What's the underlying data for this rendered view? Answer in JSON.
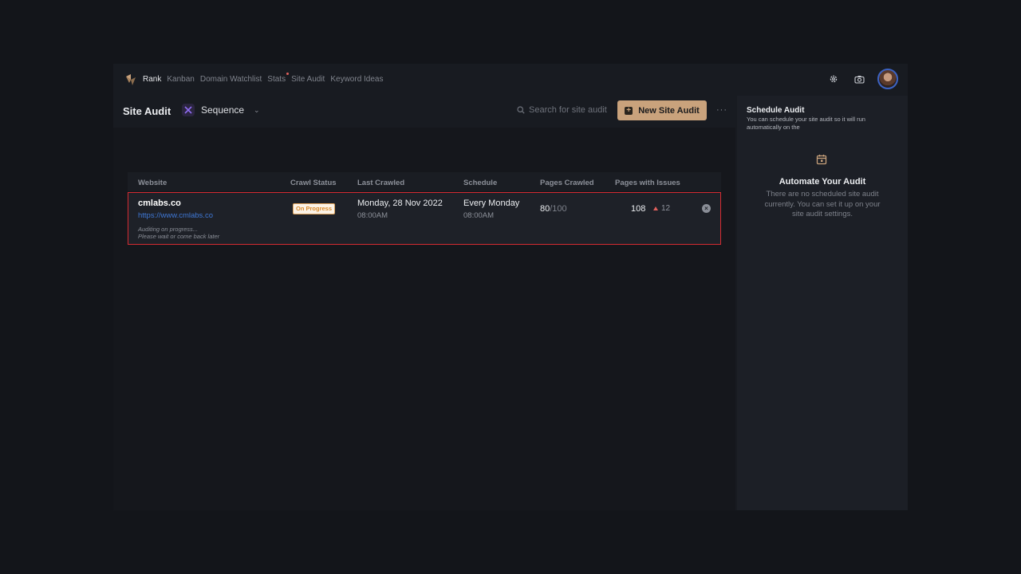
{
  "nav": {
    "items": [
      "Rank",
      "Kanban",
      "Domain Watchlist",
      "Stats",
      "Site Audit",
      "Keyword Ideas"
    ],
    "active": "Rank",
    "icons": [
      "logo-icon",
      "gear-icon",
      "camera-icon",
      "avatar"
    ]
  },
  "header": {
    "title": "Site Audit",
    "project_label": "Sequence",
    "search_placeholder": "Search for site audit",
    "new_button": "New Site Audit",
    "more": "···"
  },
  "table": {
    "columns": [
      "Website",
      "Crawl Status",
      "Last Crawled",
      "Schedule",
      "Pages Crawled",
      "Pages with Issues"
    ],
    "rows": [
      {
        "site": "cmlabs.co",
        "url": "https://www.cmlabs.co",
        "note_line1": "Auditing on progress...",
        "note_line2": "Please wait or come back later",
        "status": "On Progress",
        "last_crawled_date": "Monday, 28 Nov 2022",
        "last_crawled_time": "08:00AM",
        "schedule_day": "Every Monday",
        "schedule_time": "08:00AM",
        "pages_crawled": "80",
        "pages_total": "/100",
        "pages_issues": "108",
        "issues_delta": "12"
      }
    ]
  },
  "schedule_panel": {
    "title": "Schedule Audit",
    "description": "You can schedule your site audit so it will run automatically on the",
    "heading": "Automate Your Audit",
    "body": "There are no scheduled site audit currently. You can set it up on your site audit settings."
  },
  "colors": {
    "accent": "#c9a27c",
    "highlight_border": "#d52b32",
    "link": "#3f78d6",
    "badge_text": "#d98a2c",
    "increase": "#e0605c"
  }
}
